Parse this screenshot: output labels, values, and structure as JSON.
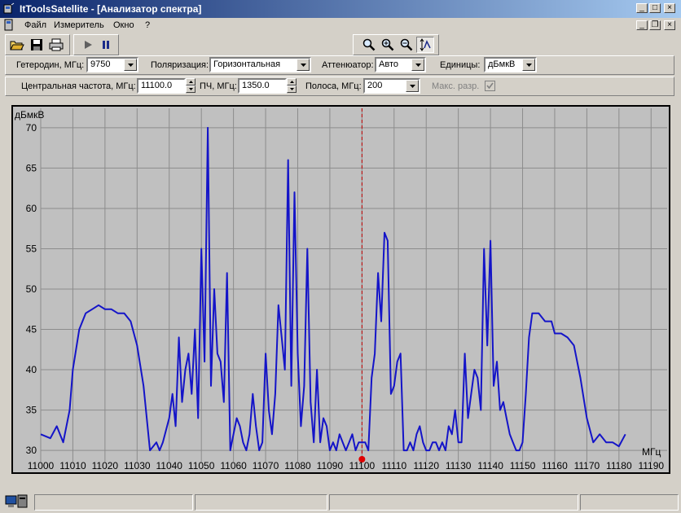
{
  "window": {
    "title": "ItToolsSatellite - [Анализатор спектра]",
    "caption_buttons": [
      "_",
      "□",
      "×"
    ]
  },
  "menu": {
    "items": [
      "Файл",
      "Измеритель",
      "Окно",
      "?"
    ],
    "mdi_buttons": [
      "_",
      "❐",
      "×"
    ]
  },
  "toolbar": {
    "icons": [
      "open-icon",
      "save-icon",
      "print-icon",
      "play-icon",
      "pause-icon",
      "zoom-icon",
      "zoom-in-icon",
      "zoom-out-icon",
      "autoscale-icon"
    ]
  },
  "settings": {
    "lo_label": "Гетеродин, МГц:",
    "lo_value": "9750",
    "polarization_label": "Поляризация:",
    "polarization_value": "Горизонтальная",
    "attenuator_label": "Аттенюатор:",
    "attenuator_value": "Авто",
    "units_label": "Единицы:",
    "units_value": "дБмкВ",
    "center_freq_label": "Центральная частота, МГц:",
    "center_freq_value": "11100.0",
    "if_label": "ПЧ, МГц:",
    "if_value": "1350.0",
    "band_label": "Полоса, МГц:",
    "band_value": "200",
    "max_res_label": "Макс. разр.",
    "max_res_checked": true
  },
  "chart_data": {
    "type": "line",
    "ylabel": "дБмкВ",
    "xlabel": "МГц",
    "xlim": [
      11000,
      11195
    ],
    "ylim": [
      29,
      71
    ],
    "x_ticks": [
      11000,
      11010,
      11020,
      11030,
      11040,
      11050,
      11060,
      11070,
      11080,
      11090,
      11100,
      11110,
      11120,
      11130,
      11140,
      11150,
      11160,
      11170,
      11180,
      11190
    ],
    "y_ticks": [
      30,
      35,
      40,
      45,
      50,
      55,
      60,
      65,
      70
    ],
    "grid": true,
    "marker_frequency": 11100,
    "colors": {
      "trace": "#1414c8",
      "marker_line": "#c00000",
      "marker_dot": "#e00000",
      "background": "#c0c0c0",
      "grid": "#8c8c8c"
    },
    "x": [
      11000,
      11003,
      11005,
      11007,
      11009,
      11010,
      11012,
      11014,
      11016,
      11018,
      11020,
      11022,
      11024,
      11026,
      11028,
      11030,
      11032,
      11034,
      11036,
      11037,
      11038,
      11040,
      11041,
      11042,
      11043,
      11044,
      11045,
      11046,
      11047,
      11048,
      11049,
      11050,
      11051,
      11052,
      11053,
      11054,
      11055,
      11056,
      11057,
      11058,
      11059,
      11060,
      11061,
      11062,
      11063,
      11064,
      11065,
      11066,
      11067,
      11068,
      11069,
      11070,
      11071,
      11072,
      11073,
      11074,
      11075,
      11076,
      11077,
      11078,
      11079,
      11080,
      11081,
      11082,
      11083,
      11084,
      11085,
      11086,
      11087,
      11088,
      11089,
      11090,
      11091,
      11092,
      11093,
      11094,
      11095,
      11096,
      11097,
      11098,
      11099,
      11100,
      11101,
      11102,
      11103,
      11104,
      11105,
      11106,
      11107,
      11108,
      11109,
      11110,
      11111,
      11112,
      11113,
      11114,
      11115,
      11116,
      11117,
      11118,
      11119,
      11120,
      11121,
      11122,
      11123,
      11124,
      11125,
      11126,
      11127,
      11128,
      11129,
      11130,
      11131,
      11132,
      11133,
      11134,
      11135,
      11136,
      11137,
      11138,
      11139,
      11140,
      11141,
      11142,
      11143,
      11144,
      11145,
      11146,
      11147,
      11148,
      11149,
      11150,
      11151,
      11152,
      11153,
      11155,
      11157,
      11159,
      11160,
      11162,
      11164,
      11166,
      11168,
      11170,
      11172,
      11174,
      11176,
      11178,
      11180,
      11182,
      11184,
      11186,
      11188,
      11190,
      11192,
      11195
    ],
    "y": [
      32,
      31.5,
      33,
      31,
      35,
      40,
      45,
      47,
      47.5,
      48,
      47.5,
      47.5,
      47,
      47,
      46,
      43,
      38,
      30,
      31,
      30,
      31,
      34,
      37,
      33,
      44,
      36,
      40,
      42,
      37,
      45,
      34,
      55,
      41,
      70,
      38,
      50,
      42,
      41,
      36,
      52,
      30,
      32,
      34,
      33,
      31,
      30,
      32,
      37,
      33,
      30,
      31,
      42,
      35,
      32,
      37,
      48,
      44,
      40,
      66,
      38,
      62,
      42,
      33,
      38,
      55,
      36,
      31,
      40,
      31,
      34,
      33,
      30,
      31,
      30,
      32,
      31,
      30,
      31,
      32,
      30,
      31,
      31,
      31,
      30,
      39,
      42,
      52,
      46,
      57,
      56,
      37,
      38,
      41,
      42,
      30,
      30,
      31,
      30,
      32,
      33,
      31,
      30,
      30,
      31,
      31,
      30,
      31,
      30,
      33,
      32,
      35,
      31,
      31,
      42,
      34,
      37,
      40,
      39,
      35,
      55,
      43,
      56,
      38,
      41,
      35,
      36,
      34,
      32,
      31,
      30,
      30,
      31,
      37,
      44,
      47,
      47,
      46,
      46,
      44.5,
      44.5,
      44,
      43,
      39,
      34,
      31,
      32,
      31,
      31,
      30.5,
      32
    ]
  },
  "status": {
    "panes": [
      "",
      "",
      "",
      ""
    ]
  }
}
